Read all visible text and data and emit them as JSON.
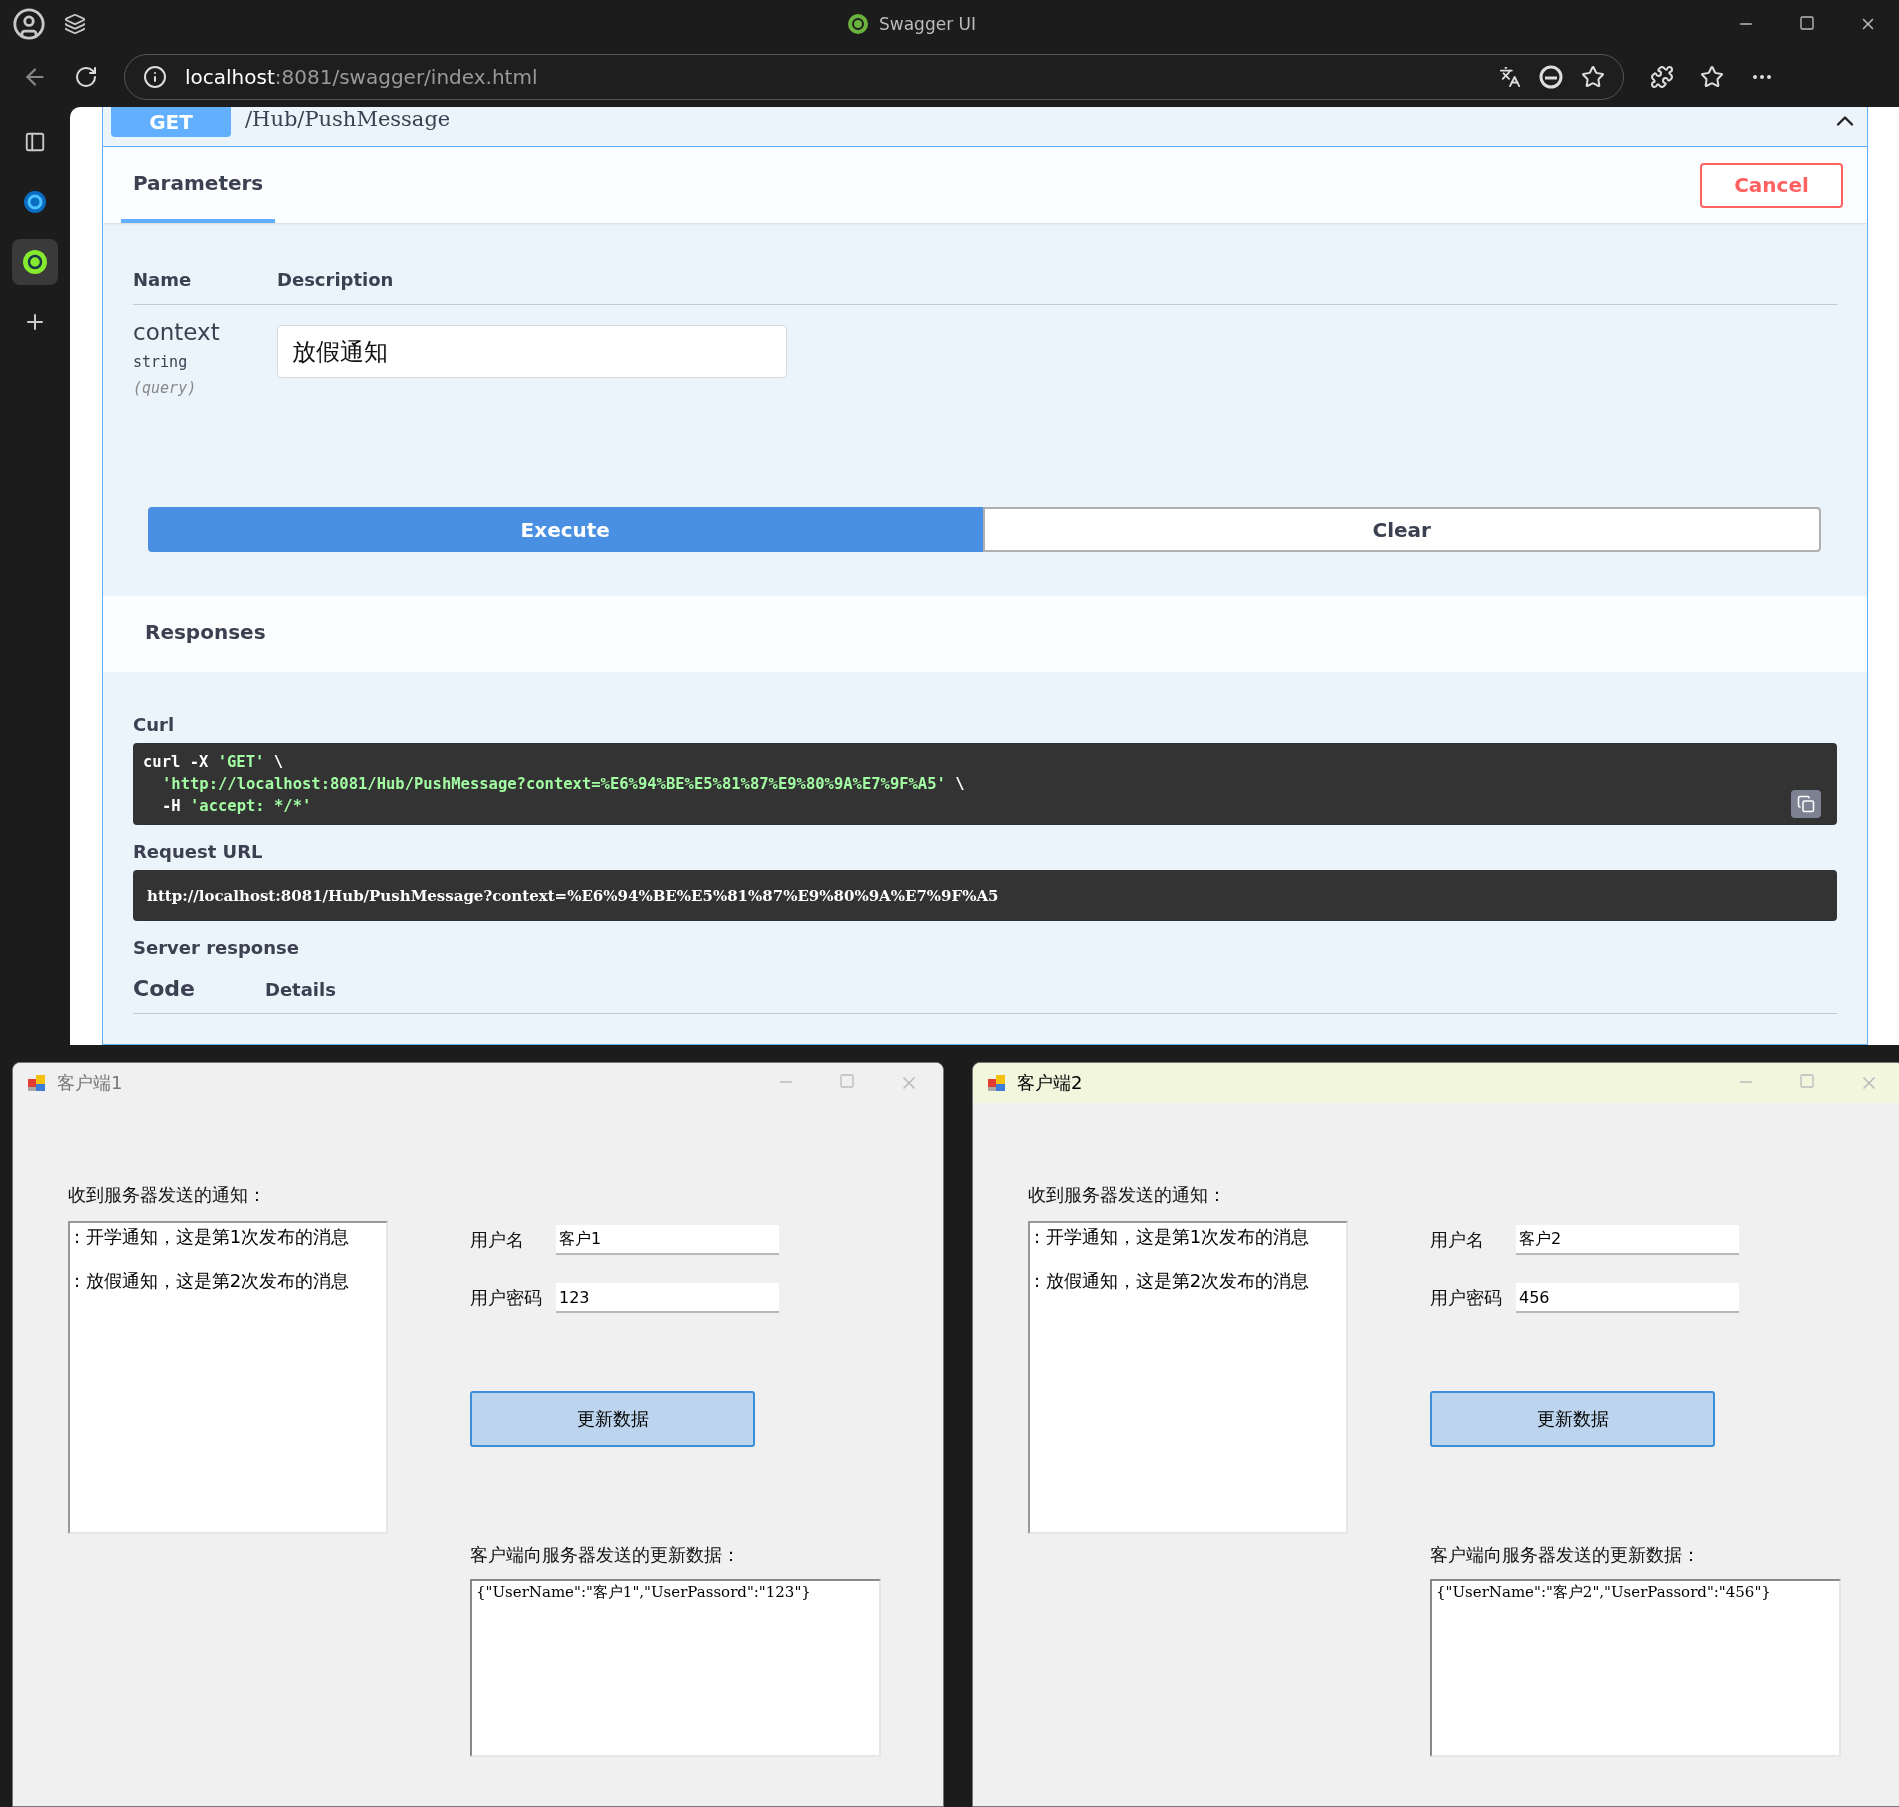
{
  "browser": {
    "title": "Swagger UI",
    "address": {
      "host": "localhost",
      "path": ":8081/swagger/index.html"
    }
  },
  "operation": {
    "method": "GET",
    "path": "/Hub/PushMessage",
    "expanded": true,
    "tabs": [
      {
        "label": "Parameters",
        "selected": true
      }
    ],
    "cancel": "Cancel",
    "columns": [
      "Name",
      "Description"
    ],
    "parameters": [
      {
        "name": "context",
        "type": "string",
        "in": "(query)",
        "value": "放假通知"
      }
    ],
    "execute": "Execute",
    "clear": "Clear",
    "responses_title": "Responses",
    "curl": {
      "label": "Curl",
      "lines": [
        {
          "indent": false,
          "parts": [
            {
              "kind": "plain",
              "text": "curl -X "
            },
            {
              "kind": "string",
              "text": "'GET'"
            },
            {
              "kind": "plain",
              "text": " \\"
            }
          ]
        },
        {
          "indent": true,
          "parts": [
            {
              "kind": "string",
              "text": "'http://localhost:8081/Hub/PushMessage?context=%E6%94%BE%E5%81%87%E9%80%9A%E7%9F%A5'"
            },
            {
              "kind": "plain",
              "text": " \\"
            }
          ]
        },
        {
          "indent": true,
          "parts": [
            {
              "kind": "plain",
              "text": "-H "
            },
            {
              "kind": "string",
              "text": "'accept: */*'"
            }
          ]
        }
      ]
    },
    "request_url": {
      "label": "Request URL",
      "value": "http://localhost:8081/Hub/PushMessage?context=%E6%94%BE%E5%81%87%E9%80%9A%E7%9F%A5"
    },
    "server_response": {
      "label": "Server response",
      "columns": [
        "Code",
        "Details"
      ]
    }
  },
  "windows": [
    {
      "title": "客户端1",
      "active": false,
      "notice_label": "收到服务器发送的通知：",
      "notices": [
        ": 开学通知，这是第1次发布的消息",
        ": 放假通知，这是第2次发布的消息"
      ],
      "username_label": "用户名",
      "username": "客户1",
      "password_label": "用户密码",
      "password": "123",
      "button": "更新数据",
      "sent_label": "客户端向服务器发送的更新数据：",
      "sent": "{\"UserName\":\"客户1\",\"UserPassord\":\"123\"}"
    },
    {
      "title": "客户端2",
      "active": true,
      "notice_label": "收到服务器发送的通知：",
      "notices": [
        ": 开学通知，这是第1次发布的消息",
        ": 放假通知，这是第2次发布的消息"
      ],
      "username_label": "用户名",
      "username": "客户2",
      "password_label": "用户密码",
      "password": "456",
      "button": "更新数据",
      "sent_label": "客户端向服务器发送的更新数据：",
      "sent": "{\"UserName\":\"客户2\",\"UserPassord\":\"456\"}"
    }
  ]
}
